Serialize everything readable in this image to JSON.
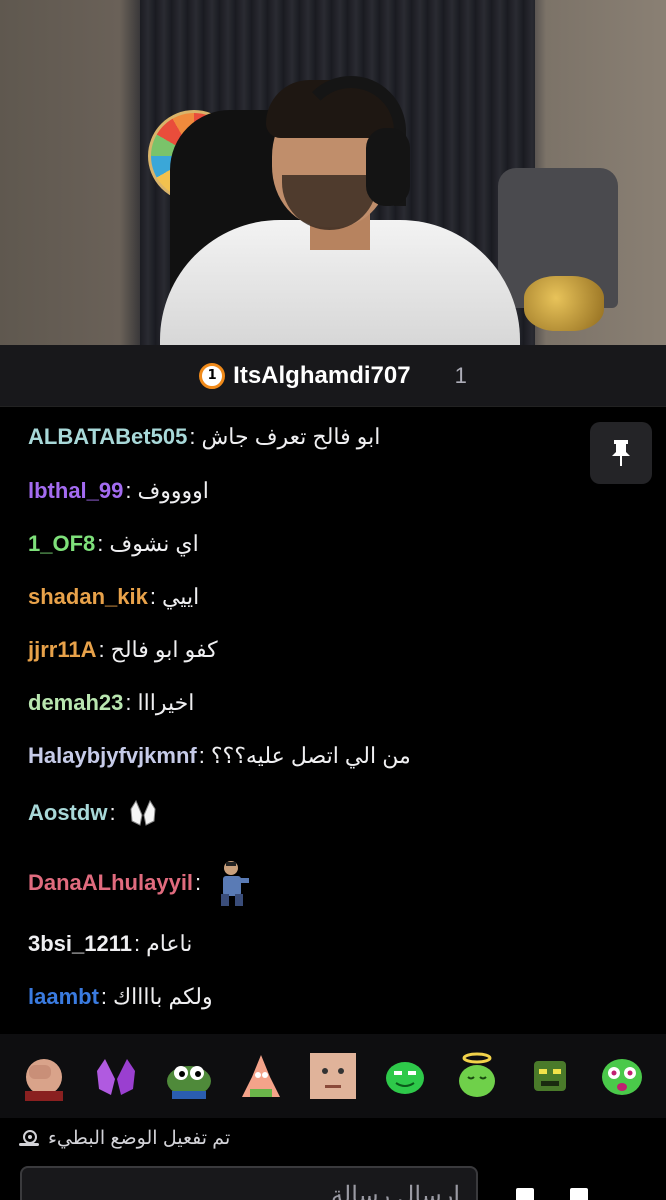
{
  "stream": {
    "channel_name": "ItsAlghamdi707",
    "badge_text": "1",
    "viewer_count": "1"
  },
  "chat": {
    "messages": [
      {
        "user": "ALBATABet505",
        "color": "#a8d8d8",
        "text": "ابو فالح تعرف جاش"
      },
      {
        "user": "lbthal_99",
        "color": "#a36bf0",
        "text": "اووووف"
      },
      {
        "user": "1_OF8",
        "color": "#7ee07a",
        "text": "اي نشوف"
      },
      {
        "user": "shadan_kik",
        "color": "#e8a24a",
        "text": "اييي"
      },
      {
        "user": "jjrr11A",
        "color": "#e8a24a",
        "text": "كفو ابو فالح"
      },
      {
        "user": "demah23",
        "color": "#b9e6b0",
        "text": "اخيرااا"
      },
      {
        "user": "Halaybjyfvjkmnf",
        "color": "#c6cbe8",
        "text": "من الي اتصل عليه؟؟؟"
      },
      {
        "user": "Aostdw",
        "color": "#a8d8d8",
        "text": "",
        "emote": "praying-hands-emote"
      },
      {
        "user": "DanaALhulayyil",
        "color": "#e06b7e",
        "text": "",
        "emote": "dancing-man-emote"
      },
      {
        "user": "3bsi_1211",
        "color": "#efeff1",
        "text": "ناعام"
      },
      {
        "user": "laambt",
        "color": "#3a7be0",
        "text": "ولكم بااااك"
      }
    ]
  },
  "emote_bar": {
    "emotes": [
      "facepalm-emote",
      "purple-hands-emote",
      "pepe-frog-emote",
      "patrick-emote",
      "face-emote",
      "green-smile-emote",
      "green-angel-emote",
      "green-angry-emote",
      "green-shock-emote"
    ]
  },
  "slow_mode": {
    "text": "تم تفعيل الوضع البطيء"
  },
  "input": {
    "placeholder": "إرسال رسالة"
  },
  "icons": {
    "pin": "pin-icon",
    "snail": "snail-icon"
  }
}
